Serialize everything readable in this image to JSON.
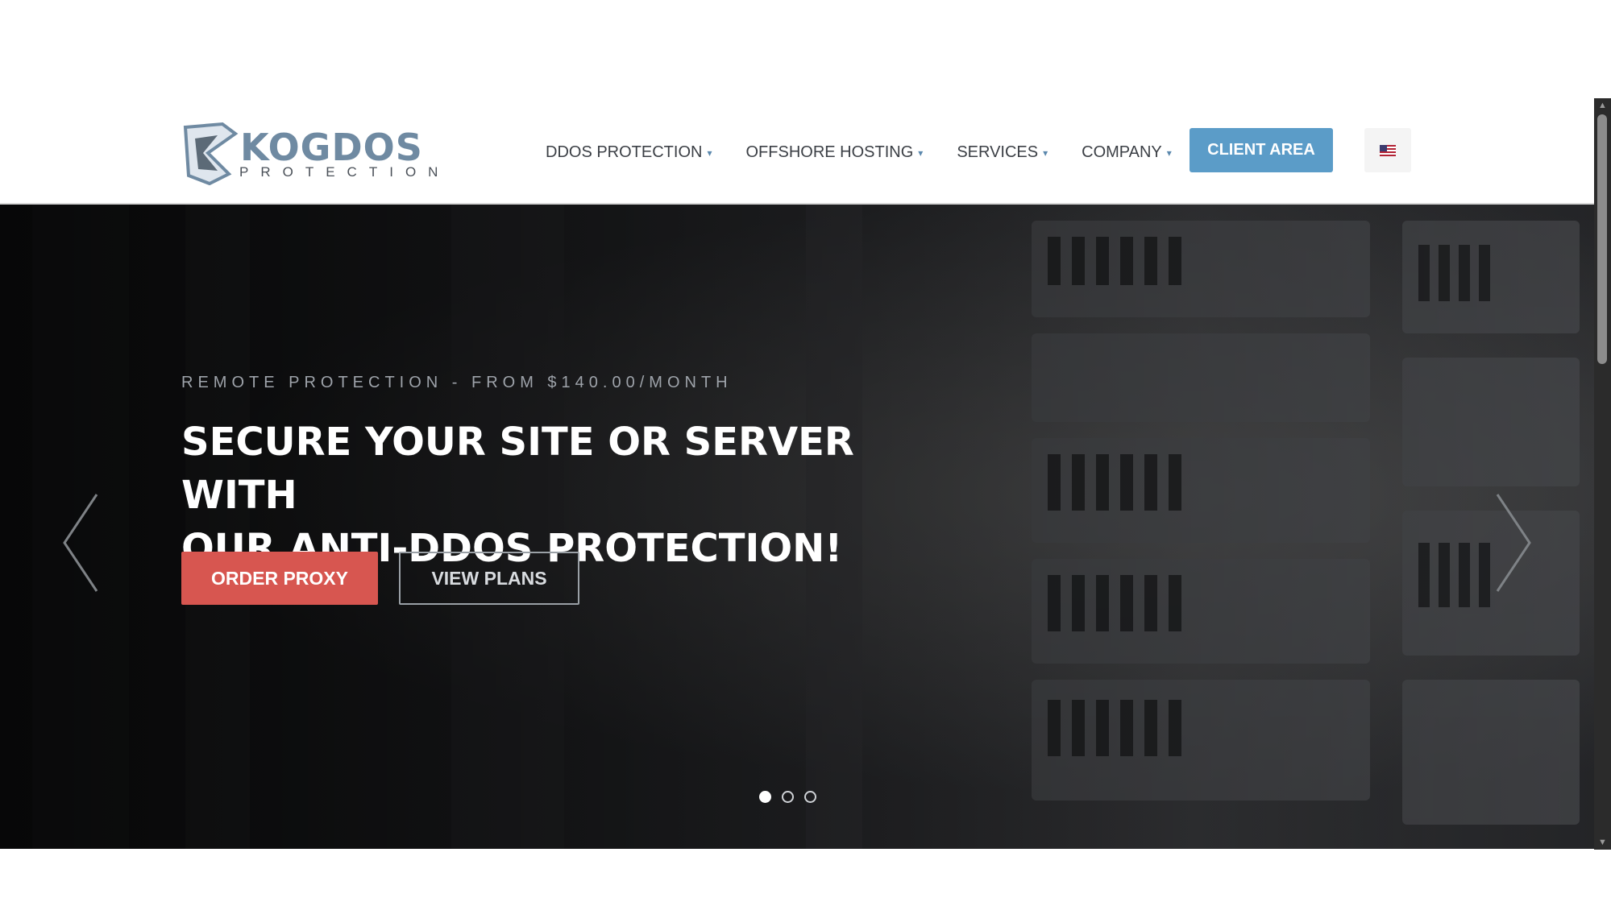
{
  "brand": {
    "logo_word_top": "KOGDOS",
    "logo_word_bottom": "PROTECTION"
  },
  "nav": {
    "items": [
      {
        "label": "DDOS PROTECTION"
      },
      {
        "label": "OFFSHORE HOSTING"
      },
      {
        "label": "SERVICES"
      },
      {
        "label": "COMPANY"
      }
    ],
    "client_area": "CLIENT AREA",
    "language_flag": "us-flag-icon"
  },
  "hero": {
    "eyebrow": "REMOTE PROTECTION - FROM $140.00/MONTH",
    "headline_line1": "SECURE YOUR SITE OR SERVER WITH",
    "headline_line2": "OUR ANTI-DDOS PROTECTION!",
    "primary_cta": "ORDER PROXY",
    "secondary_cta": "VIEW PLANS",
    "slides": {
      "count": 3,
      "active_index": 0
    }
  },
  "colors": {
    "accent_blue": "#5b9cc8",
    "cta_red": "#d75650",
    "hero_dark": "#1b1c1e"
  }
}
